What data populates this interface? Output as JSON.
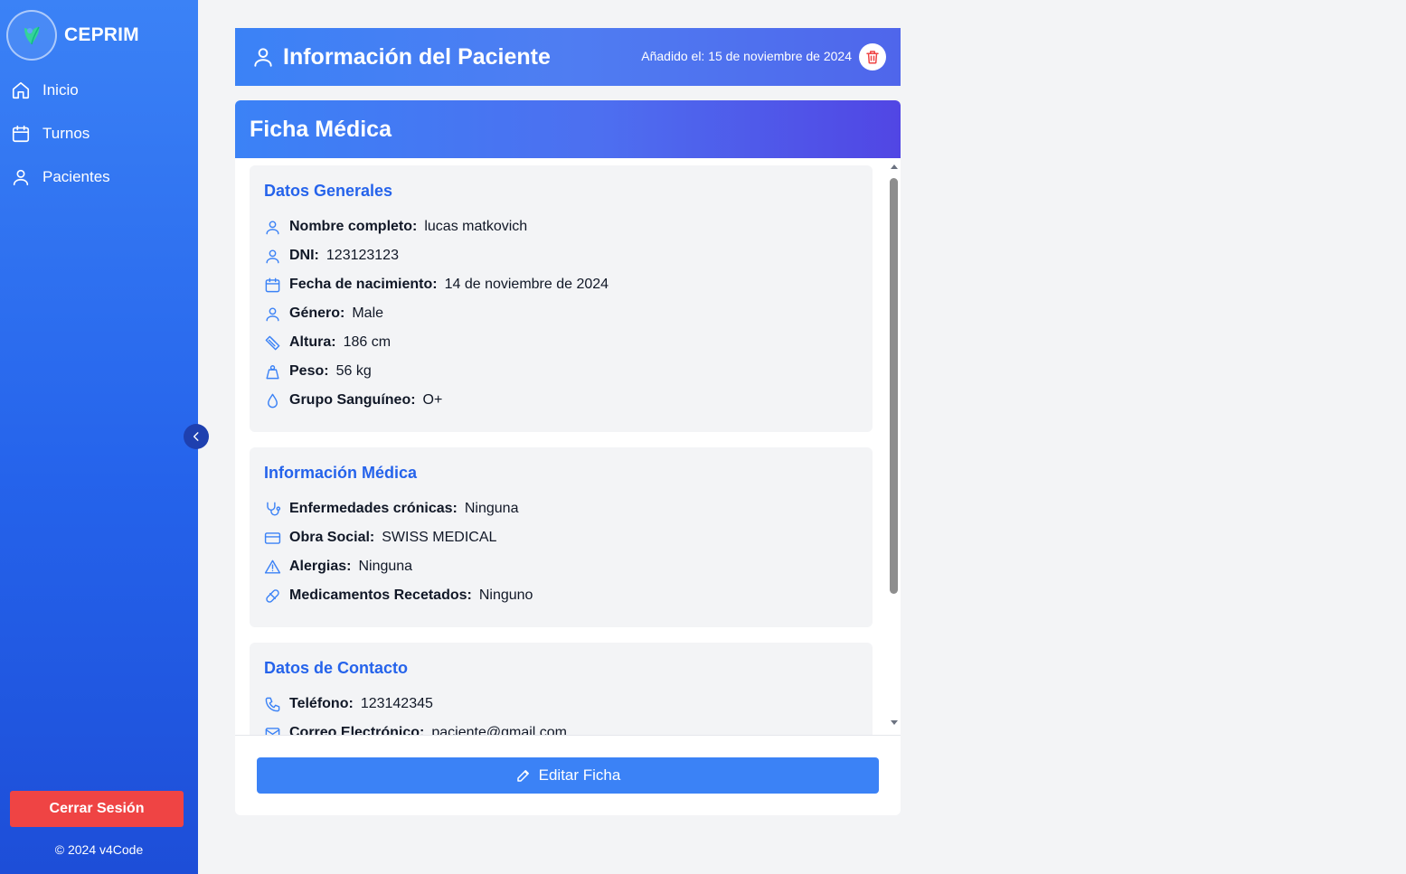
{
  "sidebar": {
    "brand": "CEPRIM",
    "nav": [
      {
        "label": "Inicio",
        "icon": "home-icon"
      },
      {
        "label": "Turnos",
        "icon": "calendar-icon"
      },
      {
        "label": "Pacientes",
        "icon": "user-icon"
      }
    ],
    "logout_label": "Cerrar Sesión",
    "copyright": "© 2024 v4Code"
  },
  "patient_header": {
    "title": "Información del Paciente",
    "added": "Añadido el: 15 de noviembre de 2024"
  },
  "ficha": {
    "title": "Ficha Médica",
    "sections": [
      {
        "title": "Datos Generales",
        "rows": [
          {
            "icon": "user-icon",
            "label": "Nombre completo:",
            "value": "lucas matkovich"
          },
          {
            "icon": "id-user-icon",
            "label": "DNI:",
            "value": "123123123"
          },
          {
            "icon": "calendar-icon",
            "label": "Fecha de nacimiento:",
            "value": "14 de noviembre de 2024"
          },
          {
            "icon": "user-icon",
            "label": "Género:",
            "value": "Male"
          },
          {
            "icon": "ruler-icon",
            "label": "Altura:",
            "value": "186 cm"
          },
          {
            "icon": "weight-icon",
            "label": "Peso:",
            "value": "56 kg"
          },
          {
            "icon": "droplet-icon",
            "label": "Grupo Sanguíneo:",
            "value": "O+"
          }
        ]
      },
      {
        "title": "Información Médica",
        "rows": [
          {
            "icon": "stethoscope-icon",
            "label": "Enfermedades crónicas:",
            "value": "Ninguna"
          },
          {
            "icon": "credit-card-icon",
            "label": "Obra Social:",
            "value": "SWISS MEDICAL"
          },
          {
            "icon": "alert-triangle-icon",
            "label": "Alergias:",
            "value": "Ninguna"
          },
          {
            "icon": "pill-icon",
            "label": "Medicamentos Recetados:",
            "value": "Ninguno"
          }
        ]
      },
      {
        "title": "Datos de Contacto",
        "rows": [
          {
            "icon": "phone-icon",
            "label": "Teléfono:",
            "value": "123142345"
          },
          {
            "icon": "mail-icon",
            "label": "Correo Electrónico:",
            "value": "paciente@gmail.com"
          }
        ]
      }
    ],
    "edit_label": "Editar Ficha"
  },
  "colors": {
    "sidebar_top": "#3b82f6",
    "sidebar_bottom": "#1d4ed8",
    "accent": "#2563eb",
    "danger": "#ef4444",
    "icon_blue": "#3b82f6"
  }
}
